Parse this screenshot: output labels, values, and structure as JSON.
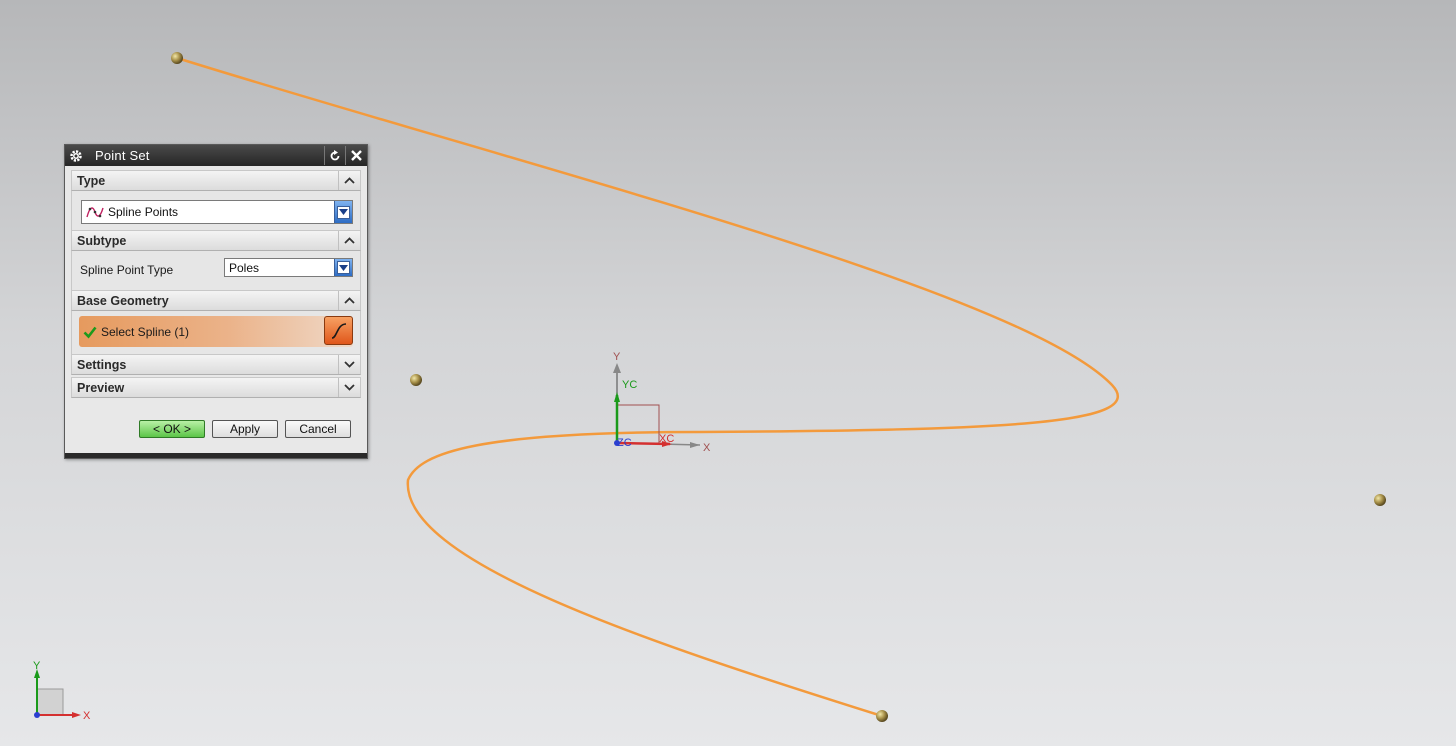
{
  "dialog": {
    "title": "Point Set",
    "sections": {
      "type": {
        "label": "Type",
        "value": "Spline Points"
      },
      "subtype": {
        "label": "Subtype",
        "field_label": "Spline Point Type",
        "value": "Poles"
      },
      "base_geometry": {
        "label": "Base Geometry",
        "select_label": "Select Spline (1)"
      },
      "settings": {
        "label": "Settings"
      },
      "preview": {
        "label": "Preview"
      }
    },
    "buttons": {
      "ok": "< OK >",
      "apply": "Apply",
      "cancel": "Cancel"
    }
  },
  "viewport": {
    "wcs_labels": {
      "y": "Y",
      "yc": "YC",
      "x": "X",
      "xc": "XC",
      "zc": "ZC"
    },
    "triad_labels": {
      "y": "Y",
      "x": "X"
    }
  },
  "colors": {
    "curve": "#f39a3c",
    "pole": "#b09a4a",
    "accent_orange": "#e0561a",
    "ok_green": "#5cc548"
  },
  "icons": [
    "gear-icon",
    "reset-icon",
    "close-icon",
    "spline-type-icon",
    "checkmark-icon",
    "spline-select-icon",
    "chevron-up-icon",
    "chevron-down-icon"
  ]
}
